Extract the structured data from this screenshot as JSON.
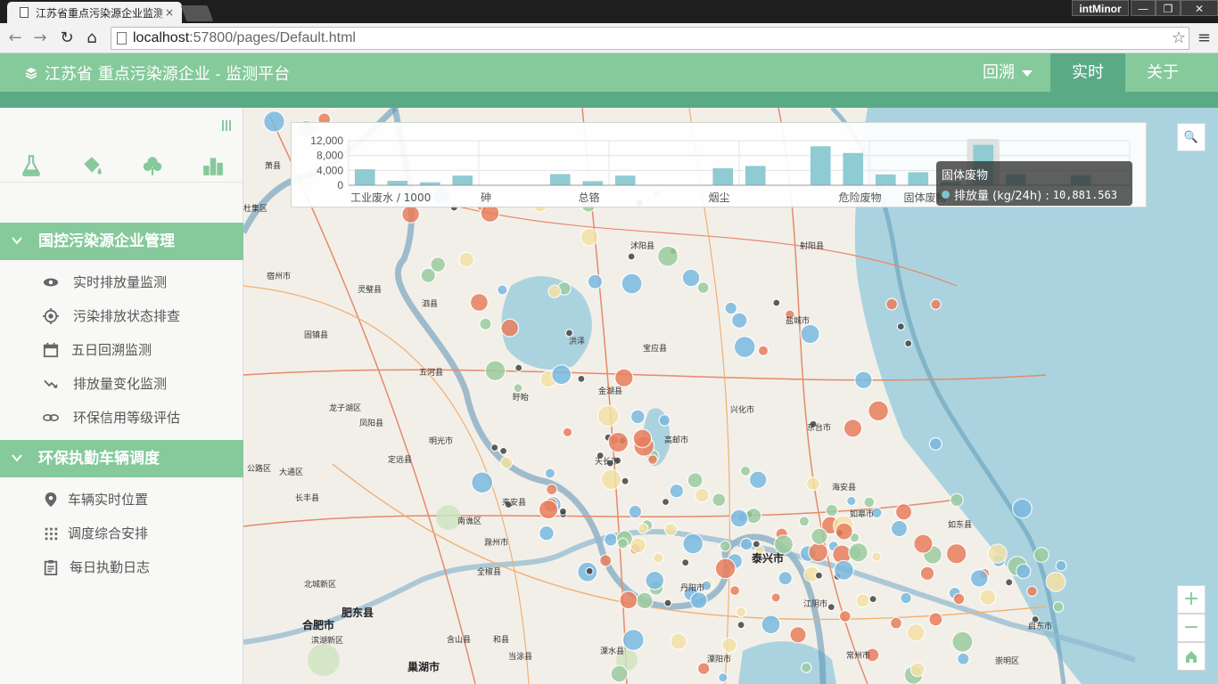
{
  "browser": {
    "tab_title": "江苏省重点污染源企业监测",
    "tab_close": "×",
    "profile": "intMinor",
    "win_min": "—",
    "win_max": "❐",
    "win_close": "✕",
    "url_host": "localhost",
    "url_path": ":57800/pages/Default.html",
    "back": "←",
    "forward": "→",
    "reload": "↻",
    "home": "⌂",
    "star": "☆",
    "menu": "≡"
  },
  "header": {
    "title": "江苏省 重点污染源企业 - 监测平台",
    "nav": {
      "back": "回溯",
      "live": "实时",
      "about": "关于"
    }
  },
  "sidebar": {
    "tools": [
      "flask-icon",
      "paint-bucket-icon",
      "tree-icon",
      "bar-chart-icon"
    ],
    "sections": [
      {
        "title": "国控污染源企业管理",
        "items": [
          {
            "label": "实时排放量监测",
            "icon": "eye-icon"
          },
          {
            "label": "污染排放状态排查",
            "icon": "target-icon"
          },
          {
            "label": "五日回溯监测",
            "icon": "calendar-icon"
          },
          {
            "label": "排放量变化监测",
            "icon": "trend-icon"
          },
          {
            "label": "环保信用等级评估",
            "icon": "link-icon"
          }
        ]
      },
      {
        "title": "环保执勤车辆调度",
        "items": [
          {
            "label": "车辆实时位置",
            "icon": "map-pin-icon"
          },
          {
            "label": "调度综合安排",
            "icon": "grid-icon"
          },
          {
            "label": "每日执勤日志",
            "icon": "clipboard-icon"
          }
        ]
      }
    ]
  },
  "chart_data": {
    "type": "bar",
    "categories": [
      "工业废水 / 1000",
      "",
      "",
      "",
      "砷",
      "",
      "",
      "总铬",
      "",
      "",
      "",
      "烟尘",
      "",
      "",
      "",
      "危险废物",
      "",
      "固体废物",
      "",
      "",
      "",
      "",
      "",
      ""
    ],
    "values": [
      4300,
      1200,
      800,
      2600,
      0,
      0,
      3000,
      1100,
      2600,
      0,
      0,
      4600,
      5200,
      0,
      10500,
      8700,
      2900,
      3500,
      900,
      10881.563,
      2900,
      0,
      2700,
      0
    ],
    "yticks": [
      "12,000",
      "8,000",
      "4,000",
      "0"
    ],
    "ylim": [
      0,
      12000
    ],
    "highlight_index": 19,
    "color": "#8ecbd3"
  },
  "tooltip": {
    "title": "固体废物",
    "label": "排放量 (kg/24h) :",
    "value": "10,881.563"
  },
  "map": {
    "places": [
      {
        "n": "萧县"
      },
      {
        "n": "宿州市"
      },
      {
        "n": "灵璧县"
      },
      {
        "n": "泗县"
      },
      {
        "n": "五河县"
      },
      {
        "n": "固镇县"
      },
      {
        "n": "龙子湖区"
      },
      {
        "n": "凤阳县"
      },
      {
        "n": "明光市"
      },
      {
        "n": "定远县"
      },
      {
        "n": "长丰县"
      },
      {
        "n": "大通区"
      },
      {
        "n": "南谯区"
      },
      {
        "n": "滁州市"
      },
      {
        "n": "来安县"
      },
      {
        "n": "全椒县"
      },
      {
        "n": "北城新区"
      },
      {
        "n": "肥东县"
      },
      {
        "n": "合肥市"
      },
      {
        "n": "滨湖新区"
      },
      {
        "n": "巢湖市"
      },
      {
        "n": "含山县"
      },
      {
        "n": "和县"
      },
      {
        "n": "天长市"
      },
      {
        "n": "泰兴市"
      },
      {
        "n": "兴化市"
      },
      {
        "n": "如东县"
      },
      {
        "n": "如皋市"
      },
      {
        "n": "海安县"
      },
      {
        "n": "宝应县"
      },
      {
        "n": "崇明区"
      },
      {
        "n": "启东市"
      },
      {
        "n": "丹阳市"
      },
      {
        "n": "常州市"
      },
      {
        "n": "溧阳市"
      },
      {
        "n": "高邮市"
      },
      {
        "n": "射阳县"
      },
      {
        "n": "洪泽"
      },
      {
        "n": "金湖县"
      },
      {
        "n": "盱眙"
      },
      {
        "n": "沭阳县"
      },
      {
        "n": "杜集区"
      },
      {
        "n": "公路区"
      },
      {
        "n": "当涂县"
      },
      {
        "n": "溧水县"
      },
      {
        "n": "东台市"
      },
      {
        "n": "盐城市"
      },
      {
        "n": "江阴市"
      }
    ]
  },
  "controls": {
    "zoom_in": "+",
    "zoom_out": "−",
    "search": "🔍"
  }
}
